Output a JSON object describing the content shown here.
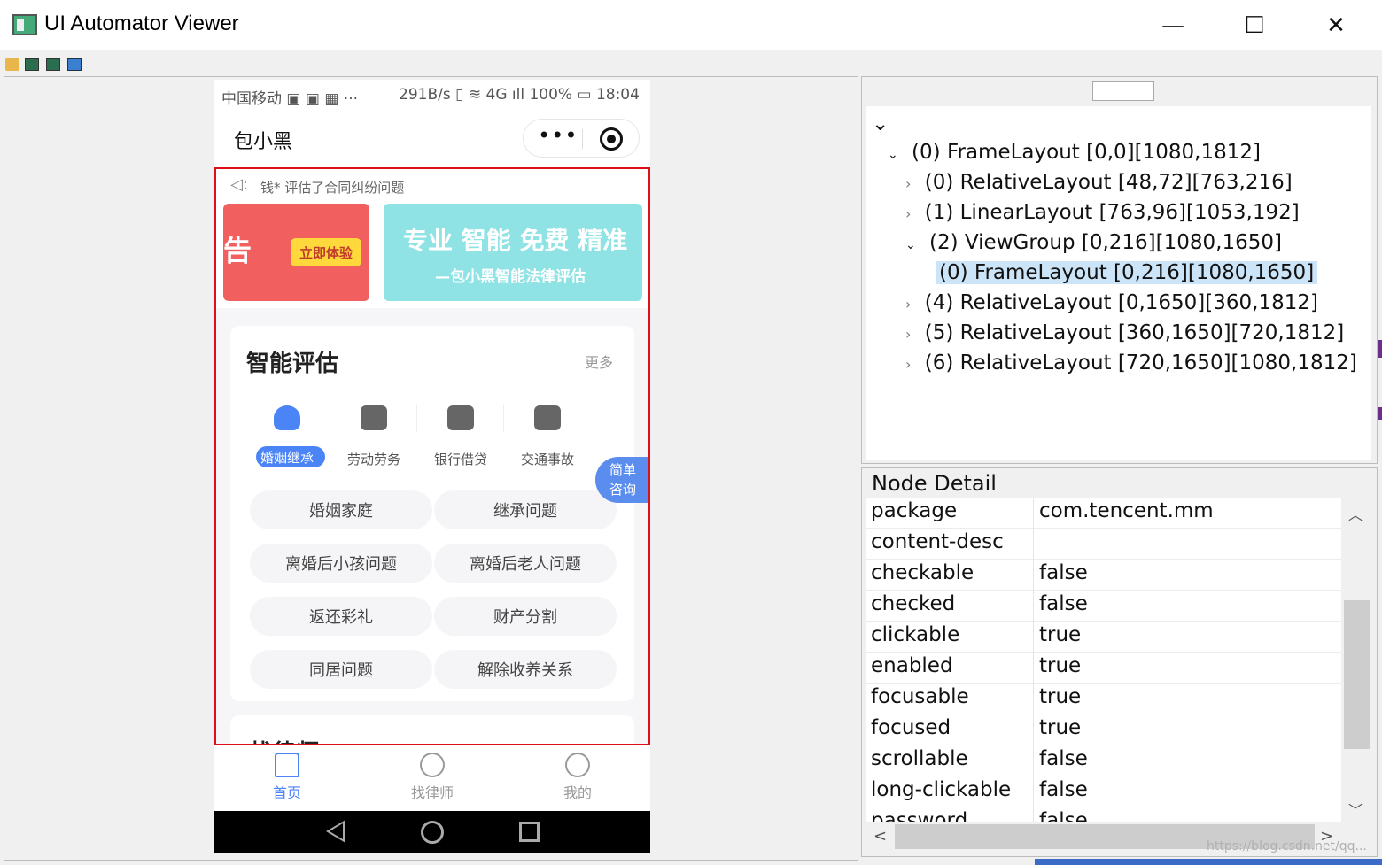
{
  "window": {
    "title": "UI Automator Viewer",
    "min_glyph": "—",
    "max_glyph": "☐",
    "close_glyph": "✕"
  },
  "toolbar": {
    "icons": [
      "open-folder-icon",
      "device-screenshot-icon",
      "device-screenshot-compressed-icon",
      "save-icon"
    ]
  },
  "phone": {
    "status_left": "中国移动 ▣ ▣ ▦ ···",
    "status_right": "291B/s ▯ ≋ 4G ıll 100% ▭ 18:04",
    "app_title": "包小黑",
    "capsule_more": "•••",
    "notice_text": "钱*  评估了合同纠纷问题",
    "banner_left_text": "告",
    "banner_left_button": "立即体验",
    "banner_right_main": "专业 智能 免费 精准",
    "banner_right_sub": "—包小黑智能法律评估",
    "section_title": "智能评估",
    "section_more": "更多",
    "categories": [
      {
        "label": "婚姻继承",
        "icon": "heart-icon",
        "active": true
      },
      {
        "label": "劳动劳务",
        "icon": "briefcase-icon",
        "active": false
      },
      {
        "label": "银行借贷",
        "icon": "bank-card-icon",
        "active": false
      },
      {
        "label": "交通事故",
        "icon": "car-icon",
        "active": false
      }
    ],
    "float_button": {
      "line1": "简单",
      "line2": "咨询"
    },
    "chips": [
      "婚姻家庭",
      "继承问题",
      "离婚后小孩问题",
      "离婚后老人问题",
      "返还彩礼",
      "财产分割",
      "同居问题",
      "解除收养关系"
    ],
    "next_section_title": "找律师",
    "tabs": [
      {
        "label": "首页",
        "icon": "home-icon",
        "active": true
      },
      {
        "label": "找律师",
        "icon": "lawyer-icon",
        "active": false
      },
      {
        "label": "我的",
        "icon": "profile-icon",
        "active": false
      }
    ]
  },
  "tree": {
    "root_arrow": "⌄",
    "nodes": [
      {
        "label": "(0) FrameLayout [0,0][1080,1812]",
        "arrow": "⌄"
      },
      {
        "label": "(0) RelativeLayout [48,72][763,216]",
        "arrow": "›"
      },
      {
        "label": "(1) LinearLayout [763,96][1053,192]",
        "arrow": "›"
      },
      {
        "label": "(2) ViewGroup [0,216][1080,1650]",
        "arrow": "⌄"
      },
      {
        "label": "(0) FrameLayout [0,216][1080,1650]",
        "arrow": "",
        "selected": true
      },
      {
        "label": "(4) RelativeLayout [0,1650][360,1812]",
        "arrow": "›"
      },
      {
        "label": "(5) RelativeLayout [360,1650][720,1812]",
        "arrow": "›"
      },
      {
        "label": "(6) RelativeLayout [720,1650][1080,1812]",
        "arrow": "›"
      }
    ]
  },
  "node_detail": {
    "title": "Node Detail",
    "rows": [
      {
        "key": "package",
        "value": "com.tencent.mm"
      },
      {
        "key": "content-desc",
        "value": ""
      },
      {
        "key": "checkable",
        "value": "false"
      },
      {
        "key": "checked",
        "value": "false"
      },
      {
        "key": "clickable",
        "value": "true"
      },
      {
        "key": "enabled",
        "value": "true"
      },
      {
        "key": "focusable",
        "value": "true"
      },
      {
        "key": "focused",
        "value": "true"
      },
      {
        "key": "scrollable",
        "value": "false"
      },
      {
        "key": "long-clickable",
        "value": "false"
      },
      {
        "key": "password",
        "value": "false"
      }
    ],
    "scroll_up": "︿",
    "scroll_down": "﹀",
    "scroll_left": "<",
    "scroll_right": ">"
  },
  "watermark": "https://blog.csdn.net/qq..."
}
